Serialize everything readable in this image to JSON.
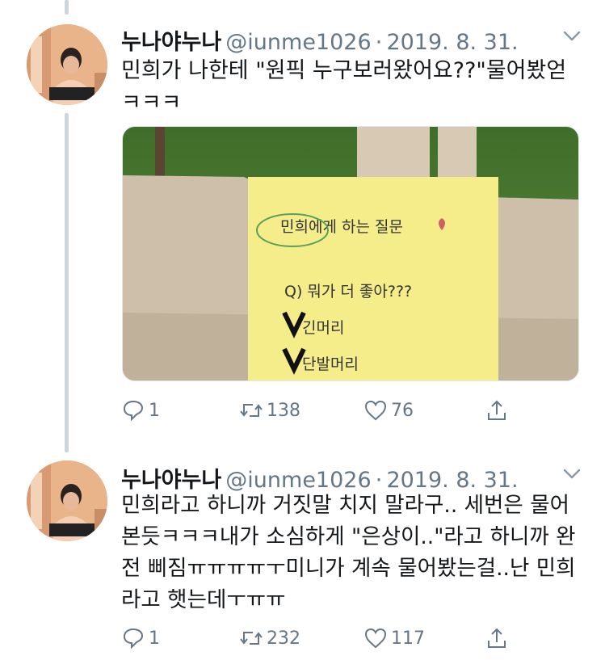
{
  "colors": {
    "text": "#14171a",
    "secondary": "#657786",
    "thread_line": "#ccd6dd",
    "border": "#e1e8ed"
  },
  "tweets": [
    {
      "name": "누나야누나",
      "handle": "@iunme1026",
      "separator": "·",
      "date": "2019. 8. 31.",
      "text": "민희가 나한테 \"원픽 누구보러왔어요??\"물어봤얻ㅋㅋㅋ",
      "media": {
        "note_title": "민희에게 하는 질문",
        "note_question": "Q) 뭐가 더 좋아???",
        "note_option_1": "긴머리",
        "note_option_2": "단발머리"
      },
      "replies": "1",
      "retweets": "138",
      "likes": "76"
    },
    {
      "name": "누나야누나",
      "handle": "@iunme1026",
      "separator": "·",
      "date": "2019. 8. 31.",
      "text": "민희라고 하니까 거짓말 치지 말라구.. 세번은 물어본듯ㅋㅋㅋ내가 소심하게 \"은상이..\"라고 하니까 완전 삐짐ㅠㅠㅠㅠㅜ미니가 계속 물어봤는걸..난 민희라고 햇는데ㅜㅠㅠ",
      "replies": "1",
      "retweets": "232",
      "likes": "117"
    }
  ]
}
